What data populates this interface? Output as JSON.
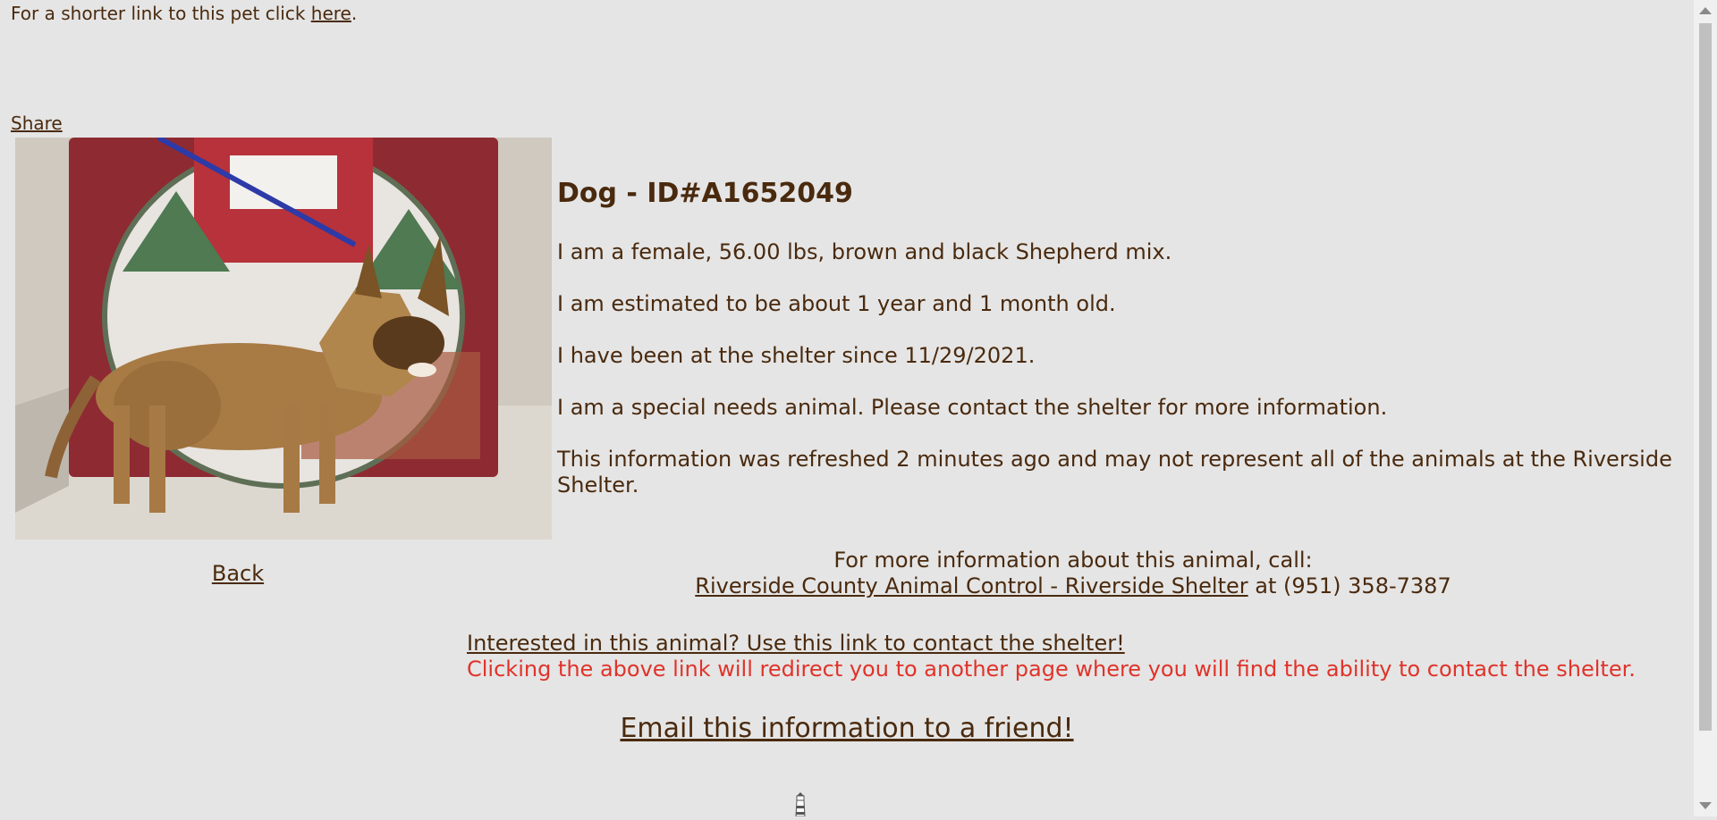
{
  "header": {
    "shortlink_prefix": "For a shorter link to this pet click ",
    "shortlink_link": "here",
    "shortlink_suffix": ".",
    "share_label": "Share"
  },
  "pet": {
    "title": "Dog - ID#A1652049",
    "details": [
      "I am a female, 56.00 lbs, brown and black Shepherd mix.",
      "I am estimated to be about 1 year and 1 month old.",
      "I have been at the shelter since 11/29/2021.",
      "I am a special needs animal. Please contact the shelter for more information.",
      "This information was refreshed 2 minutes ago and may not represent all of the animals at the Riverside Shelter."
    ]
  },
  "nav": {
    "back_label": "Back"
  },
  "call": {
    "intro": "For more information about this animal, call:",
    "shelter_name": "Riverside County Animal Control - Riverside Shelter",
    "phone_text": " at (951) 358-7387"
  },
  "contact": {
    "link_text": "Interested in this animal? Use this link to contact the shelter!",
    "notice": "Clicking the above link will redirect you to another page where you will find the ability to contact the shelter."
  },
  "email": {
    "label": "Email this information to a friend!"
  },
  "colors": {
    "background": "#e5e5e5",
    "text": "#4a2a0e",
    "notice": "#e0332a"
  },
  "icons": {
    "footer_logo": "lighthouse-icon"
  }
}
